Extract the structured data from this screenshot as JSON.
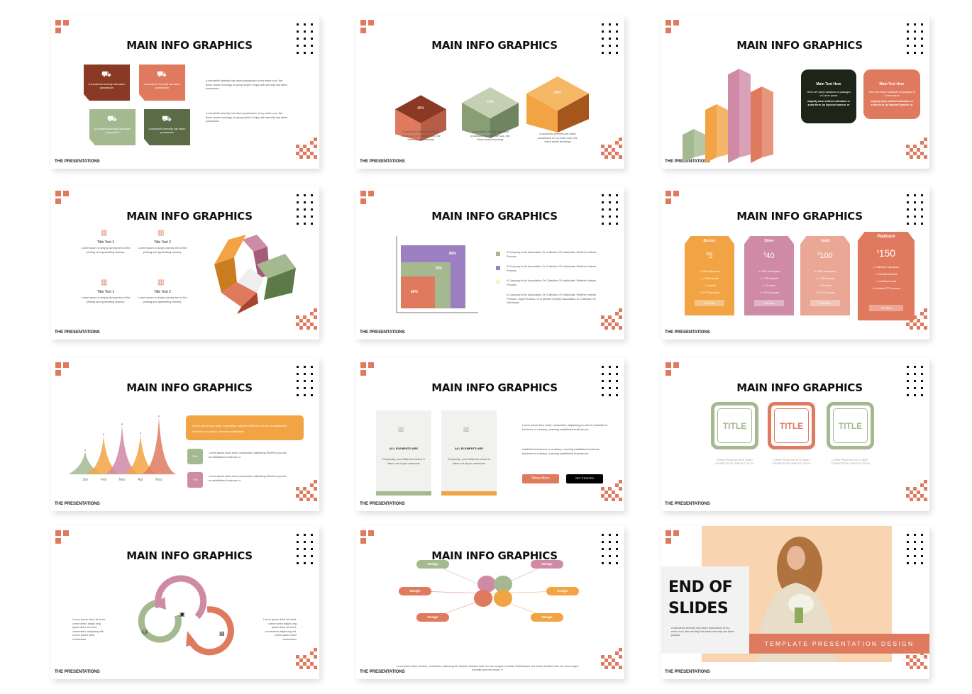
{
  "common": {
    "title": "MAIN INFO GRAPHICS",
    "footer": "THE PRESENTATIONS"
  },
  "colors": {
    "accent": "#e07a5f",
    "rust": "#8a3a24",
    "sage": "#a5b990",
    "olive": "#5b6b46",
    "orange": "#f2a444",
    "pink": "#cf8aa6",
    "purple": "#9b7fc0",
    "peach": "#f8d5b0",
    "dark": "#1f2418"
  },
  "slide1": {
    "box_text": "A wonderful serenity has taken possession",
    "box_icon": "truck-icon",
    "bullets": [
      "A wonderful serenity has taken possession of my entire soul, like these sweet mornings of spring which I enjoy with serenity has taken possession",
      "A wonderful serenity has taken possession of my entire soul, like these sweet mornings of spring which I enjoy with serenity has taken possession"
    ]
  },
  "slide2": {
    "cubes": [
      {
        "label": "45%",
        "caption": "A wonderful serenity has taken possession of my entire soul, like these sweet mornings"
      },
      {
        "label": "54%",
        "caption": "A wonderful serenity has taken possession of my entire soul, like these sweet mornings"
      },
      {
        "label": "68%",
        "caption": "A wonderful serenity has taken possession of my entire soul, like these sweet mornings"
      }
    ]
  },
  "slide3": {
    "boxes": [
      {
        "heading": "Main Text Here",
        "text": "There are many variations of passages of Lorem Ipsum",
        "text2": "majority have suffered alteration in some form, by injected humour, or"
      },
      {
        "heading": "Main Text Here",
        "text": "There are many variations of passages of Lorem Ipsum",
        "text2": "majority have suffered alteration in some form, by injected humour, or"
      }
    ]
  },
  "slide4": {
    "items": [
      {
        "title": "Title Text 1",
        "text": "Lorem Ipsum is simply dummy text of the printing and typesetting industry."
      },
      {
        "title": "Title Text 2",
        "text": "Lorem Ipsum is simply dummy text of the printing and typesetting industry."
      },
      {
        "title": "Title Text 1",
        "text": "Lorem Ipsum is simply dummy text of the printing and typesetting industry."
      },
      {
        "title": "Title Text 2",
        "text": "Lorem Ipsum is simply dummy text of the printing and typesetting industry."
      }
    ]
  },
  "slide5": {
    "squares": [
      "80%",
      "70%",
      "60%"
    ],
    "legend": [
      "A Company Is An Association Or Collection Of Individuals, Whether Natural Persons",
      "A Company Is An Association Or Collection Of Individuals, Whether Natural Persons",
      "A Company Is An Association Or Collection Of Individuals, Whether Natural Persons"
    ],
    "note": "A Company Is An Association Or Collection Of Individuals, Whether Natural Persons, Legal Persons, Or A Mixture Of Both Association Or Collection Of Individuals"
  },
  "slide6": {
    "plans": [
      {
        "name": "Bronze",
        "price": "5",
        "features": [
          "1000 web space",
          "2 GB banwith",
          "10 email",
          "2 FTP account"
        ],
        "button": "Get Plan"
      },
      {
        "name": "Silver",
        "price": "40",
        "features": [
          "2000 web space",
          "3 GB banwith",
          "15 email",
          "3 FTP account"
        ],
        "button": "Get Plan"
      },
      {
        "name": "Gold",
        "price": "100",
        "features": [
          "3000 web space",
          "4 GB banwith",
          "20 email",
          "4 FTP account"
        ],
        "button": "Get Plan"
      },
      {
        "name": "Platinum",
        "price": "150",
        "features": [
          "unlimited web space",
          "unlimited banwith",
          "unlimited email",
          "unlimited FTP account"
        ],
        "button": "Get Plan"
      }
    ],
    "currency": "$"
  },
  "slide7": {
    "chart_data": {
      "type": "area",
      "categories": [
        "Jan",
        "Feb",
        "Mar",
        "Apr",
        "May"
      ],
      "values": [
        40,
        68,
        86,
        70,
        100
      ]
    },
    "banner": "Lorem ipsum dolor amet, consectetur adipiscin Whether you are an established business or a startup, ensuring established",
    "stats": [
      {
        "badge": "30%",
        "text": "Lorem ipsum dolor amet, consectetur adipiscing Whether you are an established business or"
      },
      {
        "badge": "70%",
        "text": "Lorem ipsum dolor amet, consectetur adipiscing Whether you are an established business or"
      }
    ]
  },
  "slide8": {
    "cards": [
      {
        "heading": "ALL ELEMENTS ARE",
        "text": "Frequently, your initial font choice is taken out of your awesome"
      },
      {
        "heading": "ALL ELEMENTS ARE",
        "text": "Frequently, your initial font choice is taken out of your awesome"
      }
    ],
    "para1": "Lorem ipsum dolor amet, consectetur adipiscing you are an established business or a startup, ensuring established business an",
    "para2": "established business or a startup, ensuring established business business or a startup, ensuring established business an",
    "show_more": "Show More",
    "get_started": "GET STARTED"
  },
  "slide9": {
    "tiles": [
      {
        "label": "TITLE",
        "text": "LOREM IPSUM DOLOR SIT AMET, CONSECTETUR. AMPI ELIT, SE DO"
      },
      {
        "label": "TITLE",
        "text": "LOREM IPSUM DOLOR SIT AMET, CONSECTETUR. AMPI ELIT, SE DO"
      },
      {
        "label": "TITLE",
        "text": "LOREM IPSUM DOLOR SIT AMET, CONSECTETUR. AMPI ELIT, SE DO"
      }
    ]
  },
  "slide10": {
    "left": "Lorem ipsum dolor sit amet, conse ctetur adipis cing ipsum dolor sit amet, consectetur adipiscing elit. Lorem ipsum dolor consectetur",
    "right": "Lorem ipsum dolor sit amet, conse ctetur adipis cing ipsum dolor sit amet, consectetur adipiscing elit. Lorem ipsum dolor consectetur"
  },
  "slide11": {
    "pills": [
      "Design",
      "Design",
      "Design",
      "Design",
      "Design",
      "Design"
    ],
    "text": "Lorem ipsum dolor sit amet, consectetur adipiscing elit. Aliquam tincidunt ante nec sem congue convallis. Pellentesque sed mauris tincidunt ante nec sem congue convallis quis nisl ornare. R"
  },
  "slide12": {
    "heading": [
      "END OF",
      "SLIDES"
    ],
    "text": "A wonderful serenity has taken possession of my entire soul, like serenity has taken serenity has taken posses",
    "banner": "TEMPLATE PRESENTATION DESIGN"
  }
}
